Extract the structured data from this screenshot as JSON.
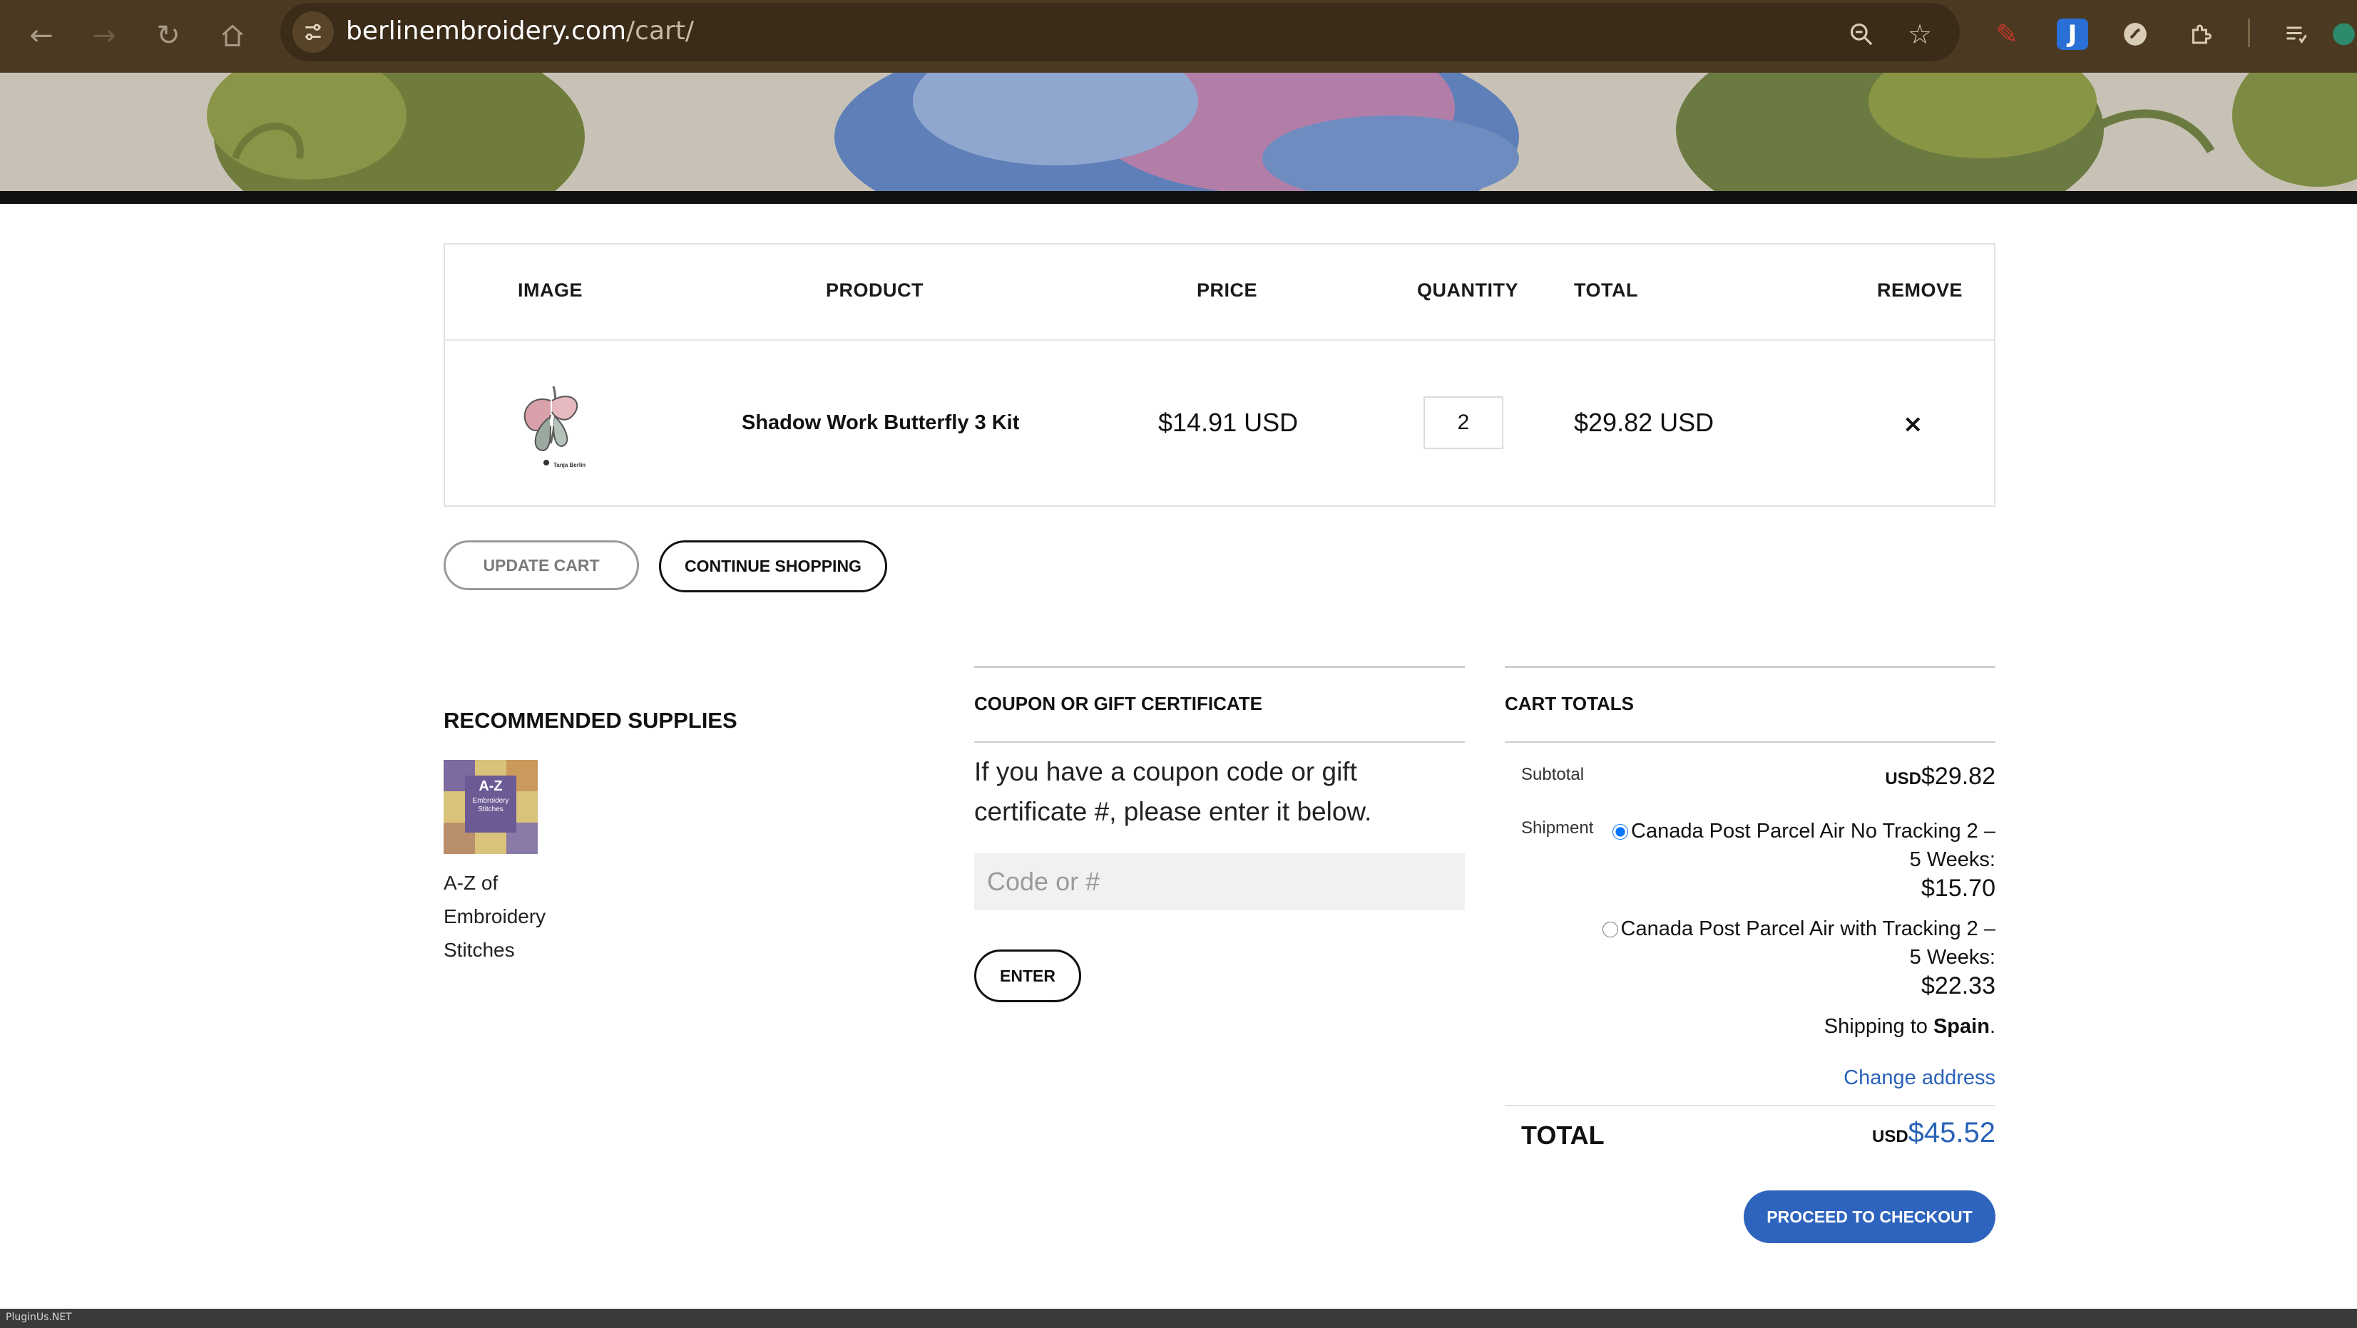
{
  "browser": {
    "url_domain": "berlinembroidery.com",
    "url_path": "/cart/",
    "icons": {
      "back": "arrow-left-icon",
      "forward": "arrow-right-icon",
      "reload": "reload-icon",
      "home": "home-icon",
      "site_info": "tune-icon",
      "zoom": "zoom-icon",
      "bookmark": "star-icon",
      "extensions": "puzzle-icon"
    },
    "accent": "#4b3922"
  },
  "cart": {
    "headers": {
      "image": "IMAGE",
      "product": "PRODUCT",
      "price": "PRICE",
      "quantity": "QUANTITY",
      "total": "TOTAL",
      "remove": "REMOVE"
    },
    "item": {
      "name": "Shadow Work Butterfly 3 Kit",
      "price": "$14.91 USD",
      "quantity": "2",
      "total": "$29.82 USD",
      "remove_symbol": "×",
      "thumb_caption": "Tanja Berlin"
    },
    "update_label": "UPDATE CART",
    "continue_label": "CONTINUE SHOPPING"
  },
  "recommended": {
    "title": "RECOMMENDED SUPPLIES",
    "thumb_title": "A-Z",
    "thumb_subtitle": "Embroidery Stitches",
    "item_name": "A-Z of Embroidery Stitches"
  },
  "coupon": {
    "title": "COUPON OR GIFT CERTIFICATE",
    "text": "If you have a coupon code or gift certificate #, please enter it below.",
    "placeholder": "Code or #",
    "enter_label": "ENTER"
  },
  "totals": {
    "title": "CART TOTALS",
    "subtotal_label": "Subtotal",
    "currency": "USD",
    "subtotal_value": "$29.82",
    "shipment_label": "Shipment",
    "options": [
      {
        "label": "Canada Post Parcel Air No Tracking 2 – 5 Weeks:",
        "amount": "$15.70",
        "selected": true
      },
      {
        "label": "Canada Post Parcel Air with Tracking 2 – 5 Weeks:",
        "amount": "$22.33",
        "selected": false
      }
    ],
    "shipping_to_prefix": "Shipping to ",
    "shipping_country": "Spain",
    "shipping_to_suffix": ".",
    "change_address": "Change address",
    "total_label": "TOTAL",
    "total_value": "$45.52",
    "checkout_label": "PROCEED TO CHECKOUT",
    "accent": "#2e64bd"
  },
  "footer": {
    "label": "PluginUs.NET"
  }
}
